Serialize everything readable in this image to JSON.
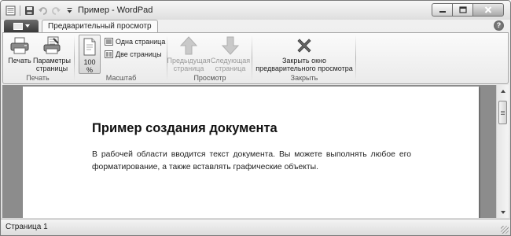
{
  "window": {
    "title": "Пример - WordPad"
  },
  "ribbon": {
    "active_tab": "Предварительный просмотр",
    "help": "?",
    "groups": {
      "print": {
        "label": "Печать",
        "print_button": "Печать",
        "page_setup_button": [
          "Параметры",
          "страницы"
        ]
      },
      "zoom": {
        "label": "Масштаб",
        "zoom_button": [
          "100",
          "%"
        ],
        "one_page": "Одна страница",
        "two_pages": "Две страницы"
      },
      "preview": {
        "label": "Просмотр",
        "prev_page": [
          "Предыдущая",
          "страница"
        ],
        "next_page": [
          "Следующая",
          "страница"
        ]
      },
      "close": {
        "label": "Закрыть",
        "close_preview": [
          "Закрыть окно",
          "предварительного просмотра"
        ]
      }
    }
  },
  "document": {
    "heading": "Пример создания документа",
    "body": "В рабочей области вводится текст документа. Вы можете выполнять любое его форматирование, а также вставлять графические объекты."
  },
  "status_bar": {
    "page": "Страница 1"
  },
  "icons": {
    "save": "save-icon",
    "undo": "undo-icon",
    "redo": "redo-icon",
    "customize": "qat-dropdown-icon",
    "print": "printer-icon",
    "page_setup": "page-setup-icon",
    "zoom": "zoom-page-icon",
    "prev": "arrow-up-icon",
    "next": "arrow-down-icon",
    "close": "close-x-icon"
  }
}
